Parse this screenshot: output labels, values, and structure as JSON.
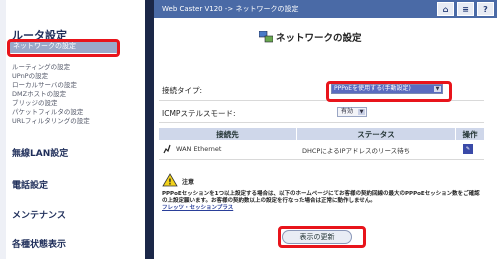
{
  "topbar": {
    "breadcrumb": "Web Caster V120 -> ネットワークの設定",
    "buttons": [
      {
        "icon": "home-icon",
        "glyph": "⌂"
      },
      {
        "icon": "list-icon",
        "glyph": "≡"
      },
      {
        "icon": "help-icon",
        "glyph": "?"
      }
    ]
  },
  "sidebar": {
    "title": "ルータ設定",
    "current": "ネットワークの設定",
    "items": [
      "ルーティングの設定",
      "UPnPの設定",
      "ローカルサーバの設定",
      "DMZホストの設定",
      "ブリッジの設定",
      "パケットフィルタの設定",
      "URLフィルタリングの設定"
    ],
    "sections": [
      "無線LAN設定",
      "電話設定",
      "メンテナンス",
      "各種状態表示"
    ]
  },
  "main": {
    "title": "ネットワークの設定",
    "connection_type": {
      "label": "接続タイプ:",
      "value": "PPPoEを使用する(手動設定)"
    },
    "icmp": {
      "label": "ICMPステルスモード:",
      "value": "有効"
    },
    "table": {
      "headers": [
        "接続先",
        "ステータス",
        "操作"
      ],
      "rows": [
        {
          "dest": "WAN Ethernet",
          "status": "DHCPによるIPアドレスのリース待ち",
          "op_icon": "edit-icon"
        }
      ]
    },
    "notice": {
      "label": "注意",
      "text": "PPPoEセッションを1つ以上設定する場合は、以下のホームページにてお客様の契約回線の最大のPPPoEセッション数をご確認の上設定願います。お客様の契約数以上の設定を行なった場合は正常に動作しません。",
      "link": "フレッツ・セッションプラス"
    },
    "refresh_button": "表示の更新"
  },
  "colors": {
    "accent": "#4a6aa6",
    "highlight": "#e8141b",
    "sidebar_dark": "#1b2748"
  }
}
